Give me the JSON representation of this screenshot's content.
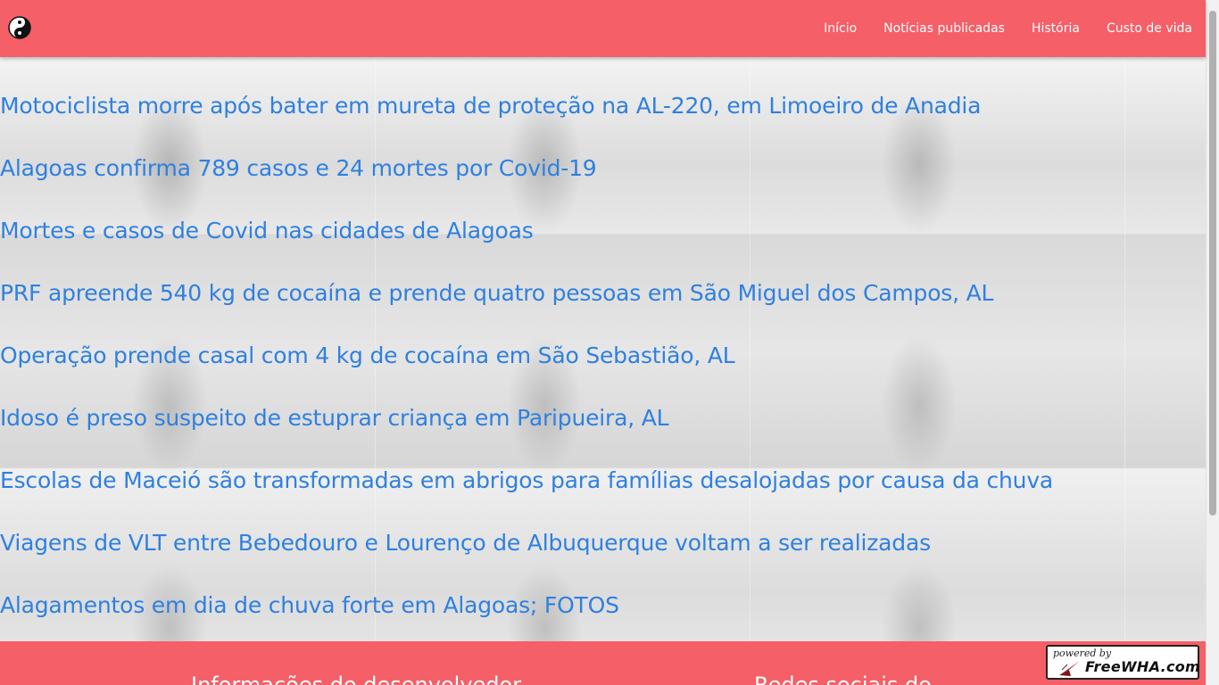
{
  "navbar": {
    "logo_icon": "yin-yang-icon",
    "links": [
      "Início",
      "Notícias publicadas",
      "História",
      "Custo de vida"
    ]
  },
  "news": [
    "Motociclista morre após bater em mureta de proteção na AL-220, em Limoeiro de Anadia",
    "Alagoas confirma 789 casos e 24 mortes por Covid-19",
    "Mortes e casos de Covid nas cidades de Alagoas",
    "PRF apreende 540 kg de cocaína e prende quatro pessoas em São Miguel dos Campos, AL",
    "Operação prende casal com 4 kg de cocaína em São Sebastião, AL",
    "Idoso é preso suspeito de estuprar criança em Paripueira, AL",
    "Escolas de Maceió são transformadas em abrigos para famílias desalojadas por causa da chuva",
    "Viagens de VLT entre Bebedouro e Lourenço de Albuquerque voltam a ser realizadas",
    "Alagamentos em dia de chuva forte em Alagoas; FOTOS"
  ],
  "footer": {
    "developer_heading": "Informações do desenvolvedor",
    "social_heading": "Redes sociais do"
  },
  "badge": {
    "small_text": "powered by",
    "main_text": "FreeWHA.com"
  },
  "colors": {
    "brand": "#f55f67",
    "link": "#2f80e0"
  }
}
